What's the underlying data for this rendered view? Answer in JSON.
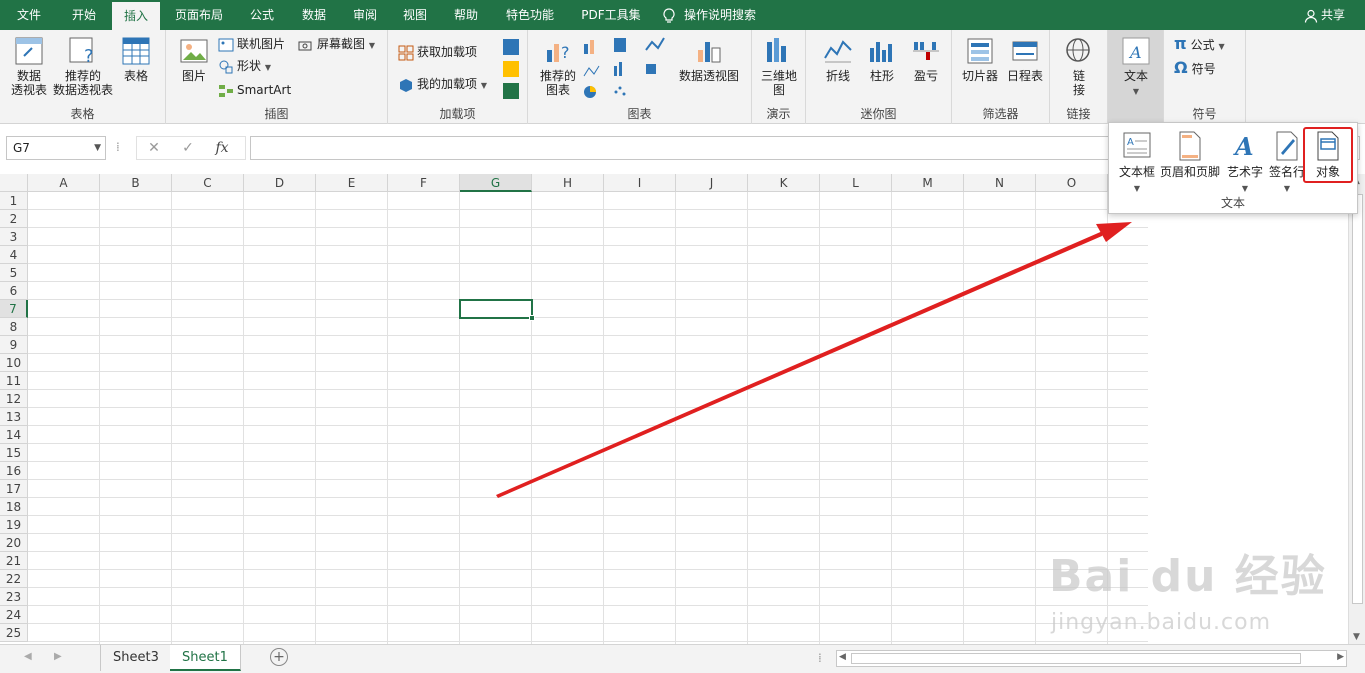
{
  "menu": {
    "tabs": [
      "文件",
      "开始",
      "插入",
      "页面布局",
      "公式",
      "数据",
      "审阅",
      "视图",
      "帮助",
      "特色功能",
      "PDF工具集"
    ],
    "active_tab": "插入",
    "search_hint": "操作说明搜索",
    "share": "共享"
  },
  "ribbon": {
    "tables": {
      "label": "表格",
      "pivot": "数据\n透视表",
      "recommended_pivot": "推荐的\n数据透视表",
      "table": "表格"
    },
    "illustrations": {
      "label": "插图",
      "picture": "图片",
      "online_picture": "联机图片",
      "shapes": "形状",
      "smartart": "SmartArt",
      "screenshot": "屏幕截图"
    },
    "addins": {
      "label": "加载项",
      "get_addins": "获取加载项",
      "my_addins": "我的加载项"
    },
    "charts": {
      "label": "图表",
      "recommended": "推荐的\n图表",
      "pivot_chart": "数据透视图"
    },
    "tours": {
      "label": "演示",
      "map3d": "三维地\n图"
    },
    "sparklines": {
      "label": "迷你图",
      "line": "折线",
      "column": "柱形",
      "winloss": "盈亏"
    },
    "filters": {
      "label": "筛选器",
      "slicer": "切片器",
      "timeline": "日程表"
    },
    "links": {
      "label": "链接",
      "link": "链\n接"
    },
    "text": {
      "label": "文本",
      "text": "文本"
    },
    "symbols": {
      "label": "符号",
      "equation": "公式",
      "symbol": "符号"
    }
  },
  "text_dropdown": {
    "label": "文本",
    "items": [
      "文本框",
      "页眉和页脚",
      "艺术字",
      "签名行",
      "对象"
    ]
  },
  "formula_bar": {
    "name_box": "G7",
    "formula": ""
  },
  "grid": {
    "columns": [
      "A",
      "B",
      "C",
      "D",
      "E",
      "F",
      "G",
      "H",
      "I",
      "J",
      "K",
      "L",
      "M",
      "N",
      "O"
    ],
    "rows": [
      "1",
      "2",
      "3",
      "4",
      "5",
      "6",
      "7",
      "8",
      "9",
      "10",
      "11",
      "12",
      "13",
      "14",
      "15",
      "16",
      "17",
      "18",
      "19",
      "20",
      "21",
      "22",
      "23",
      "24",
      "25"
    ],
    "selected_cell": "G7"
  },
  "sheets": {
    "tabs": [
      "Sheet3",
      "Sheet1"
    ],
    "active": "Sheet1"
  },
  "watermark": {
    "brand": "Bai du 经验",
    "url": "jingyan.baidu.com"
  },
  "colors": {
    "accent": "#217346",
    "highlight": "#e02020"
  }
}
